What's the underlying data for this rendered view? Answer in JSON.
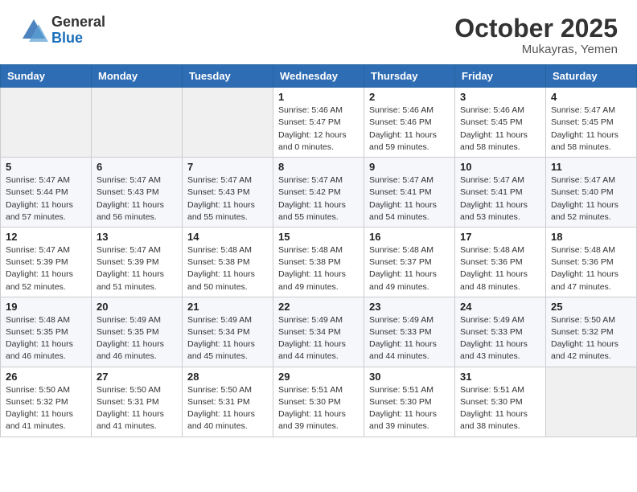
{
  "header": {
    "logo_general": "General",
    "logo_blue": "Blue",
    "month_title": "October 2025",
    "location": "Mukayras, Yemen"
  },
  "weekdays": [
    "Sunday",
    "Monday",
    "Tuesday",
    "Wednesday",
    "Thursday",
    "Friday",
    "Saturday"
  ],
  "weeks": [
    [
      {
        "day": "",
        "sunrise": "",
        "sunset": "",
        "daylight": "",
        "empty": true
      },
      {
        "day": "",
        "sunrise": "",
        "sunset": "",
        "daylight": "",
        "empty": true
      },
      {
        "day": "",
        "sunrise": "",
        "sunset": "",
        "daylight": "",
        "empty": true
      },
      {
        "day": "1",
        "sunrise": "Sunrise: 5:46 AM",
        "sunset": "Sunset: 5:47 PM",
        "daylight": "Daylight: 12 hours and 0 minutes."
      },
      {
        "day": "2",
        "sunrise": "Sunrise: 5:46 AM",
        "sunset": "Sunset: 5:46 PM",
        "daylight": "Daylight: 11 hours and 59 minutes."
      },
      {
        "day": "3",
        "sunrise": "Sunrise: 5:46 AM",
        "sunset": "Sunset: 5:45 PM",
        "daylight": "Daylight: 11 hours and 58 minutes."
      },
      {
        "day": "4",
        "sunrise": "Sunrise: 5:47 AM",
        "sunset": "Sunset: 5:45 PM",
        "daylight": "Daylight: 11 hours and 58 minutes."
      }
    ],
    [
      {
        "day": "5",
        "sunrise": "Sunrise: 5:47 AM",
        "sunset": "Sunset: 5:44 PM",
        "daylight": "Daylight: 11 hours and 57 minutes."
      },
      {
        "day": "6",
        "sunrise": "Sunrise: 5:47 AM",
        "sunset": "Sunset: 5:43 PM",
        "daylight": "Daylight: 11 hours and 56 minutes."
      },
      {
        "day": "7",
        "sunrise": "Sunrise: 5:47 AM",
        "sunset": "Sunset: 5:43 PM",
        "daylight": "Daylight: 11 hours and 55 minutes."
      },
      {
        "day": "8",
        "sunrise": "Sunrise: 5:47 AM",
        "sunset": "Sunset: 5:42 PM",
        "daylight": "Daylight: 11 hours and 55 minutes."
      },
      {
        "day": "9",
        "sunrise": "Sunrise: 5:47 AM",
        "sunset": "Sunset: 5:41 PM",
        "daylight": "Daylight: 11 hours and 54 minutes."
      },
      {
        "day": "10",
        "sunrise": "Sunrise: 5:47 AM",
        "sunset": "Sunset: 5:41 PM",
        "daylight": "Daylight: 11 hours and 53 minutes."
      },
      {
        "day": "11",
        "sunrise": "Sunrise: 5:47 AM",
        "sunset": "Sunset: 5:40 PM",
        "daylight": "Daylight: 11 hours and 52 minutes."
      }
    ],
    [
      {
        "day": "12",
        "sunrise": "Sunrise: 5:47 AM",
        "sunset": "Sunset: 5:39 PM",
        "daylight": "Daylight: 11 hours and 52 minutes."
      },
      {
        "day": "13",
        "sunrise": "Sunrise: 5:47 AM",
        "sunset": "Sunset: 5:39 PM",
        "daylight": "Daylight: 11 hours and 51 minutes."
      },
      {
        "day": "14",
        "sunrise": "Sunrise: 5:48 AM",
        "sunset": "Sunset: 5:38 PM",
        "daylight": "Daylight: 11 hours and 50 minutes."
      },
      {
        "day": "15",
        "sunrise": "Sunrise: 5:48 AM",
        "sunset": "Sunset: 5:38 PM",
        "daylight": "Daylight: 11 hours and 49 minutes."
      },
      {
        "day": "16",
        "sunrise": "Sunrise: 5:48 AM",
        "sunset": "Sunset: 5:37 PM",
        "daylight": "Daylight: 11 hours and 49 minutes."
      },
      {
        "day": "17",
        "sunrise": "Sunrise: 5:48 AM",
        "sunset": "Sunset: 5:36 PM",
        "daylight": "Daylight: 11 hours and 48 minutes."
      },
      {
        "day": "18",
        "sunrise": "Sunrise: 5:48 AM",
        "sunset": "Sunset: 5:36 PM",
        "daylight": "Daylight: 11 hours and 47 minutes."
      }
    ],
    [
      {
        "day": "19",
        "sunrise": "Sunrise: 5:48 AM",
        "sunset": "Sunset: 5:35 PM",
        "daylight": "Daylight: 11 hours and 46 minutes."
      },
      {
        "day": "20",
        "sunrise": "Sunrise: 5:49 AM",
        "sunset": "Sunset: 5:35 PM",
        "daylight": "Daylight: 11 hours and 46 minutes."
      },
      {
        "day": "21",
        "sunrise": "Sunrise: 5:49 AM",
        "sunset": "Sunset: 5:34 PM",
        "daylight": "Daylight: 11 hours and 45 minutes."
      },
      {
        "day": "22",
        "sunrise": "Sunrise: 5:49 AM",
        "sunset": "Sunset: 5:34 PM",
        "daylight": "Daylight: 11 hours and 44 minutes."
      },
      {
        "day": "23",
        "sunrise": "Sunrise: 5:49 AM",
        "sunset": "Sunset: 5:33 PM",
        "daylight": "Daylight: 11 hours and 44 minutes."
      },
      {
        "day": "24",
        "sunrise": "Sunrise: 5:49 AM",
        "sunset": "Sunset: 5:33 PM",
        "daylight": "Daylight: 11 hours and 43 minutes."
      },
      {
        "day": "25",
        "sunrise": "Sunrise: 5:50 AM",
        "sunset": "Sunset: 5:32 PM",
        "daylight": "Daylight: 11 hours and 42 minutes."
      }
    ],
    [
      {
        "day": "26",
        "sunrise": "Sunrise: 5:50 AM",
        "sunset": "Sunset: 5:32 PM",
        "daylight": "Daylight: 11 hours and 41 minutes."
      },
      {
        "day": "27",
        "sunrise": "Sunrise: 5:50 AM",
        "sunset": "Sunset: 5:31 PM",
        "daylight": "Daylight: 11 hours and 41 minutes."
      },
      {
        "day": "28",
        "sunrise": "Sunrise: 5:50 AM",
        "sunset": "Sunset: 5:31 PM",
        "daylight": "Daylight: 11 hours and 40 minutes."
      },
      {
        "day": "29",
        "sunrise": "Sunrise: 5:51 AM",
        "sunset": "Sunset: 5:30 PM",
        "daylight": "Daylight: 11 hours and 39 minutes."
      },
      {
        "day": "30",
        "sunrise": "Sunrise: 5:51 AM",
        "sunset": "Sunset: 5:30 PM",
        "daylight": "Daylight: 11 hours and 39 minutes."
      },
      {
        "day": "31",
        "sunrise": "Sunrise: 5:51 AM",
        "sunset": "Sunset: 5:30 PM",
        "daylight": "Daylight: 11 hours and 38 minutes."
      },
      {
        "day": "",
        "sunrise": "",
        "sunset": "",
        "daylight": "",
        "empty": true
      }
    ]
  ]
}
